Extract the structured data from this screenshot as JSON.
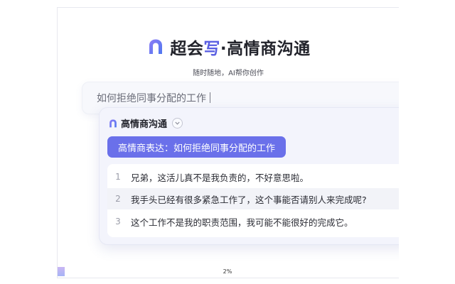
{
  "header": {
    "brand_prefix": "超会",
    "brand_accent": "写",
    "brand_suffix": "·高情商沟通",
    "subtitle": "随时随地，AI帮你创作",
    "logo_icon": "app-logo-icon"
  },
  "input": {
    "value": "如何拒绝同事分配的工作"
  },
  "card": {
    "title": "高情商沟通",
    "dropdown_icon": "chevron-down-icon",
    "prompt_tag": "高情商表达：如何拒绝同事分配的工作",
    "items": [
      {
        "num": "1",
        "text": "兄弟，这活儿真不是我负责的，不好意思啦。"
      },
      {
        "num": "2",
        "text": "我手头已经有很多紧急工作了，这个事能否请别人来完成呢?"
      },
      {
        "num": "3",
        "text": "这个工作不是我的职责范围，我可能不能很好的完成它。"
      }
    ]
  },
  "footer": {
    "progress": "2%"
  },
  "colors": {
    "accent": "#5a5fe2",
    "tag_bg": "#6a70ea",
    "card_bg": "#f3f4fc"
  }
}
